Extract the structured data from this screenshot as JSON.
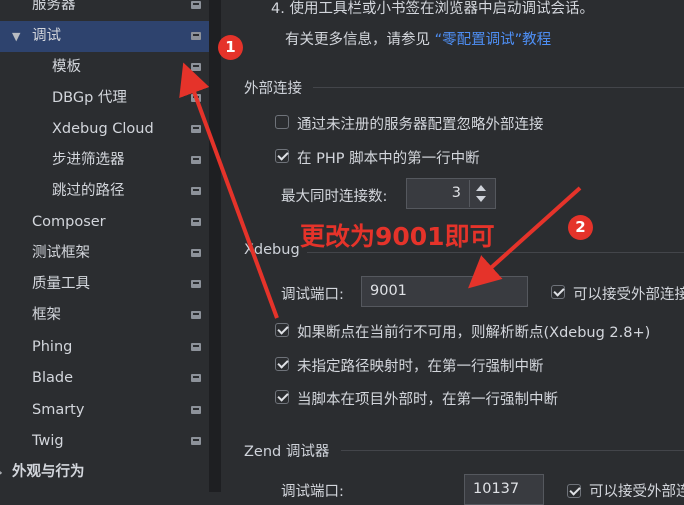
{
  "sidebar": {
    "items": [
      {
        "label": "服务器"
      },
      {
        "label": "调试"
      },
      {
        "label": "模板"
      },
      {
        "label": "DBGp 代理"
      },
      {
        "label": "Xdebug Cloud"
      },
      {
        "label": "步进筛选器"
      },
      {
        "label": "跳过的路径"
      },
      {
        "label": "Composer"
      },
      {
        "label": "测试框架"
      },
      {
        "label": "质量工具"
      },
      {
        "label": "框架"
      },
      {
        "label": "Phing"
      },
      {
        "label": "Blade"
      },
      {
        "label": "Smarty"
      },
      {
        "label": "Twig"
      },
      {
        "label": "外观与行为"
      }
    ],
    "selected": "调试"
  },
  "content": {
    "step4": "4. 使用工具栏或小书签在浏览器中启动调试会话。",
    "more_info_prefix": "有关更多信息，请参见 ",
    "more_info_link": "“零配置调试”教程",
    "external": {
      "title": "外部连接",
      "ignore_unregistered": {
        "label": "通过未注册的服务器配置忽略外部连接",
        "checked": false
      },
      "break_first_line": {
        "label": "在 PHP 脚本中的第一行中断",
        "checked": true
      },
      "max_connections_label": "最大同时连接数:",
      "max_connections_value": "3"
    },
    "xdebug": {
      "title": "Xdebug",
      "port_label": "调试端口:",
      "port_value": "9001",
      "accept_external": {
        "label": "可以接受外部连接",
        "checked": true
      },
      "resolve_breakpoint": {
        "label": "如果断点在当前行不可用，则解析断点(Xdebug 2.8+)",
        "checked": true
      },
      "force_break_unmapped": {
        "label": "未指定路径映射时，在第一行强制中断",
        "checked": true
      },
      "force_break_outside": {
        "label": "当脚本在项目外部时，在第一行强制中断",
        "checked": true
      }
    },
    "zend": {
      "title": "Zend 调试器",
      "port_label": "调试端口:",
      "port_value": "10137",
      "accept_external": {
        "label": "可以接受外部连接",
        "checked": true
      }
    }
  },
  "annotations": {
    "badge1": "1",
    "badge2": "2",
    "note": "更改为9001即可",
    "color": "#e5332a"
  }
}
